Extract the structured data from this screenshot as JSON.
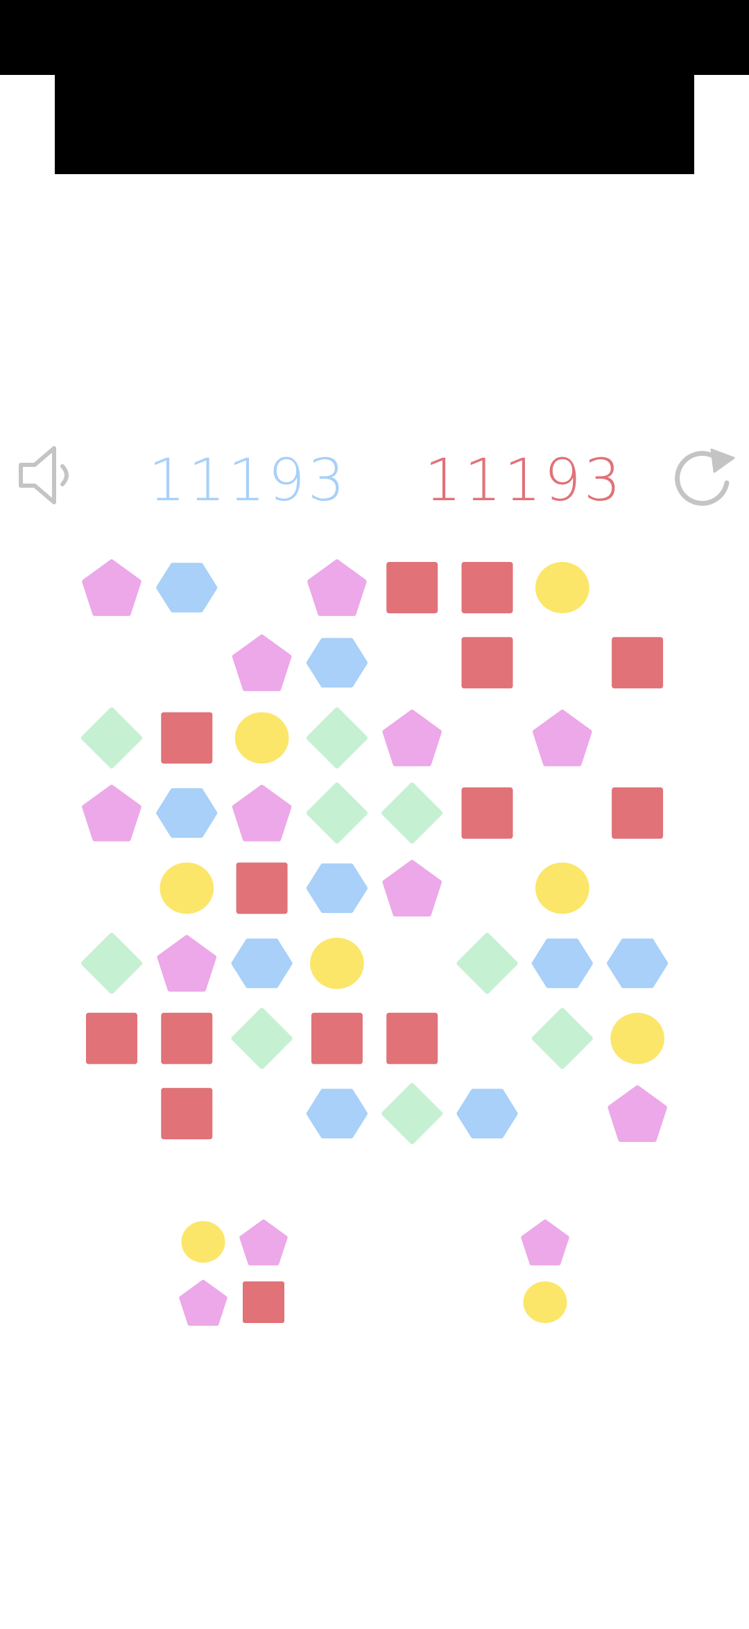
{
  "scores": {
    "player": "11193",
    "best": "11193"
  },
  "colors": {
    "pentagon": "#eca8e8",
    "hexagon": "#a8d0f8",
    "square": "#e07278",
    "circle": "#fbe66a",
    "diamond": "#c6f0d2",
    "icon": "#c4c4c4",
    "player_score": "#a8d0f8",
    "best_score": "#e07278"
  },
  "icons": {
    "sound": "speaker-muted-icon",
    "restart": "restart-icon"
  },
  "board": {
    "rows": 8,
    "cols": 8,
    "cells": [
      [
        "pentagon",
        "hexagon",
        null,
        "pentagon",
        "square",
        "square",
        "circle",
        null
      ],
      [
        null,
        null,
        "pentagon",
        "hexagon",
        null,
        "square",
        null,
        "square"
      ],
      [
        "diamond",
        "square",
        "circle",
        "diamond",
        "pentagon",
        null,
        "pentagon",
        null
      ],
      [
        "pentagon",
        "hexagon",
        "pentagon",
        "diamond",
        "diamond",
        "square",
        null,
        "square"
      ],
      [
        null,
        "circle",
        "square",
        "hexagon",
        "pentagon",
        null,
        "circle",
        null
      ],
      [
        "diamond",
        "pentagon",
        "hexagon",
        "circle",
        null,
        "diamond",
        "hexagon",
        "hexagon"
      ],
      [
        "square",
        "square",
        "diamond",
        "square",
        "square",
        null,
        "diamond",
        "circle"
      ],
      [
        null,
        "square",
        null,
        "hexagon",
        "diamond",
        "hexagon",
        null,
        "pentagon"
      ]
    ]
  },
  "tray": [
    {
      "name": "tray-piece-1",
      "cells": [
        [
          "circle",
          "pentagon"
        ],
        [
          "pentagon",
          "square"
        ]
      ]
    },
    {
      "name": "tray-piece-2",
      "cells": [
        [
          "pentagon"
        ],
        [
          "circle"
        ]
      ]
    }
  ]
}
